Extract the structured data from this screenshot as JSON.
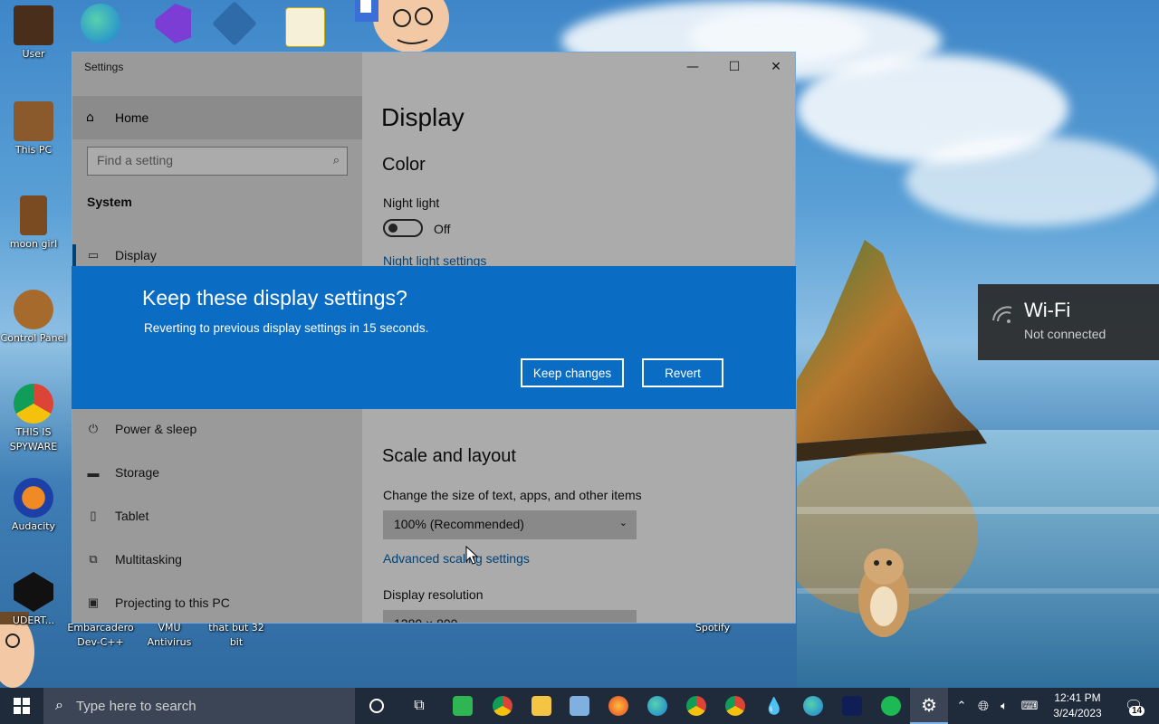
{
  "desktop": {
    "icons": [
      {
        "label": "User"
      },
      {
        "label": "This PC"
      },
      {
        "label": "moon girl"
      },
      {
        "label": "Control Panel"
      },
      {
        "label": "THIS IS SPYWARE"
      },
      {
        "label": "Audacity"
      },
      {
        "label": "UDERT..."
      },
      {
        "label": "Embarcadero Dev-C++"
      },
      {
        "label": "VMU Antivirus"
      },
      {
        "label": "that but 32 bit"
      },
      {
        "label": "Spotify"
      }
    ]
  },
  "settings": {
    "window_title": "Settings",
    "controls": {
      "minimize": "—",
      "maximize": "☐",
      "close": "✕"
    },
    "nav": {
      "home_label": "Home",
      "search_placeholder": "Find a setting",
      "section": "System",
      "items": [
        "Display",
        "Power & sleep",
        "Storage",
        "Tablet",
        "Multitasking",
        "Projecting to this PC"
      ]
    },
    "main": {
      "page_title": "Display",
      "color_heading": "Color",
      "night_light_label": "Night light",
      "night_light_state": "Off",
      "night_light_settings_link": "Night light settings",
      "scale_heading": "Scale and layout",
      "scale_label": "Change the size of text, apps, and other items",
      "scale_value": "100% (Recommended)",
      "advanced_scaling_link": "Advanced scaling settings",
      "resolution_label": "Display resolution",
      "resolution_value": "1280 × 800"
    }
  },
  "keep_dialog": {
    "title": "Keep these display settings?",
    "message": "Reverting to previous display settings in 15 seconds.",
    "keep_label": "Keep changes",
    "revert_label": "Revert"
  },
  "wifi_toast": {
    "name": "Wi-Fi",
    "status": "Not connected"
  },
  "taskbar": {
    "search_placeholder": "Type here to search",
    "time": "12:41 PM",
    "date": "3/24/2023",
    "notification_count": "14"
  },
  "colors": {
    "dialog_blue": "#0a6cc2",
    "taskbar": "#1f2a3a"
  }
}
